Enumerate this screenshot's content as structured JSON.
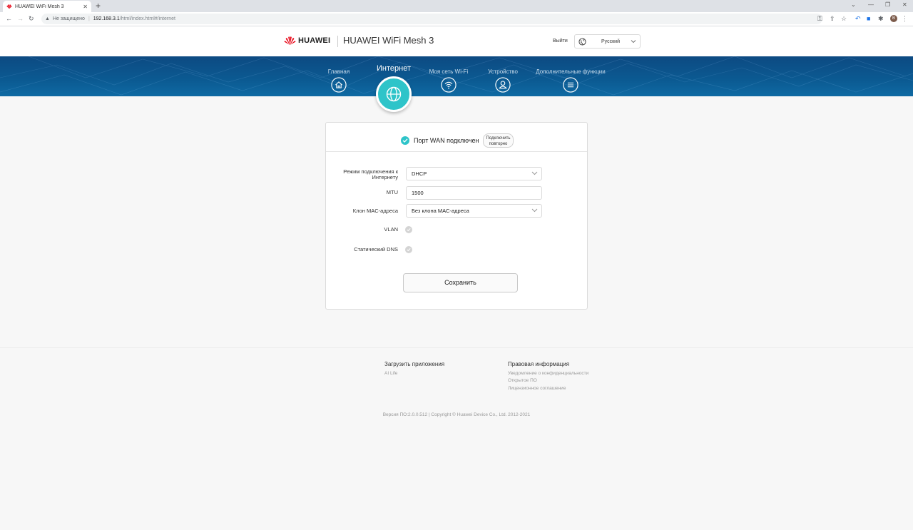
{
  "browser": {
    "tab_title": "HUAWEI WiFi Mesh 3",
    "tab_close": "✕",
    "new_tab": "+",
    "security_label": "Не защищено",
    "url_host": "192.168.3.1",
    "url_path": "/html/index.html#/internet",
    "window_controls": [
      "⌄",
      "—",
      "❐",
      "✕"
    ]
  },
  "header": {
    "brand": "HUAWEI",
    "product": "HUAWEI WiFi Mesh 3",
    "logout": "Выйти",
    "language": "Русский"
  },
  "nav": {
    "items": [
      {
        "label": "Главная",
        "icon": "home-icon"
      },
      {
        "label": "Интернет",
        "icon": "globe-icon",
        "active": true
      },
      {
        "label": "Моя сеть Wi-Fi",
        "icon": "wifi-icon"
      },
      {
        "label": "Устройство",
        "icon": "user-icon"
      },
      {
        "label": "Дополнительные функции",
        "icon": "menu-icon"
      }
    ]
  },
  "wan": {
    "status": "Порт WAN подключен",
    "reconnect_line1": "Подключить",
    "reconnect_line2": "повторно"
  },
  "form": {
    "mode_label_line1": "Режим подключения к",
    "mode_label_line2": "Интернету",
    "mode_value": "DHCP",
    "mtu_label": "MTU",
    "mtu_value": "1500",
    "mac_label": "Клон MAC-адреса",
    "mac_value": "Без клона MAC-адреса",
    "vlan_label": "VLAN",
    "vlan_enabled": false,
    "dns_label": "Статический DNS",
    "dns_enabled": false,
    "save": "Сохранить"
  },
  "footer": {
    "apps_title": "Загрузить приложения",
    "apps_links": [
      "AI Life"
    ],
    "legal_title": "Правовая информация",
    "legal_links": [
      "Уведомление о конфиденциальности",
      "Открытое ПО",
      "Лицензионное соглашение"
    ],
    "copyright": "Версия ПО:2.0.0.512 | Copyright © Huawei Device Co., Ltd. 2012-2021"
  },
  "colors": {
    "accent": "#2ec4c9",
    "nav_band": "#0b5a92",
    "brand_red": "#e60012"
  }
}
